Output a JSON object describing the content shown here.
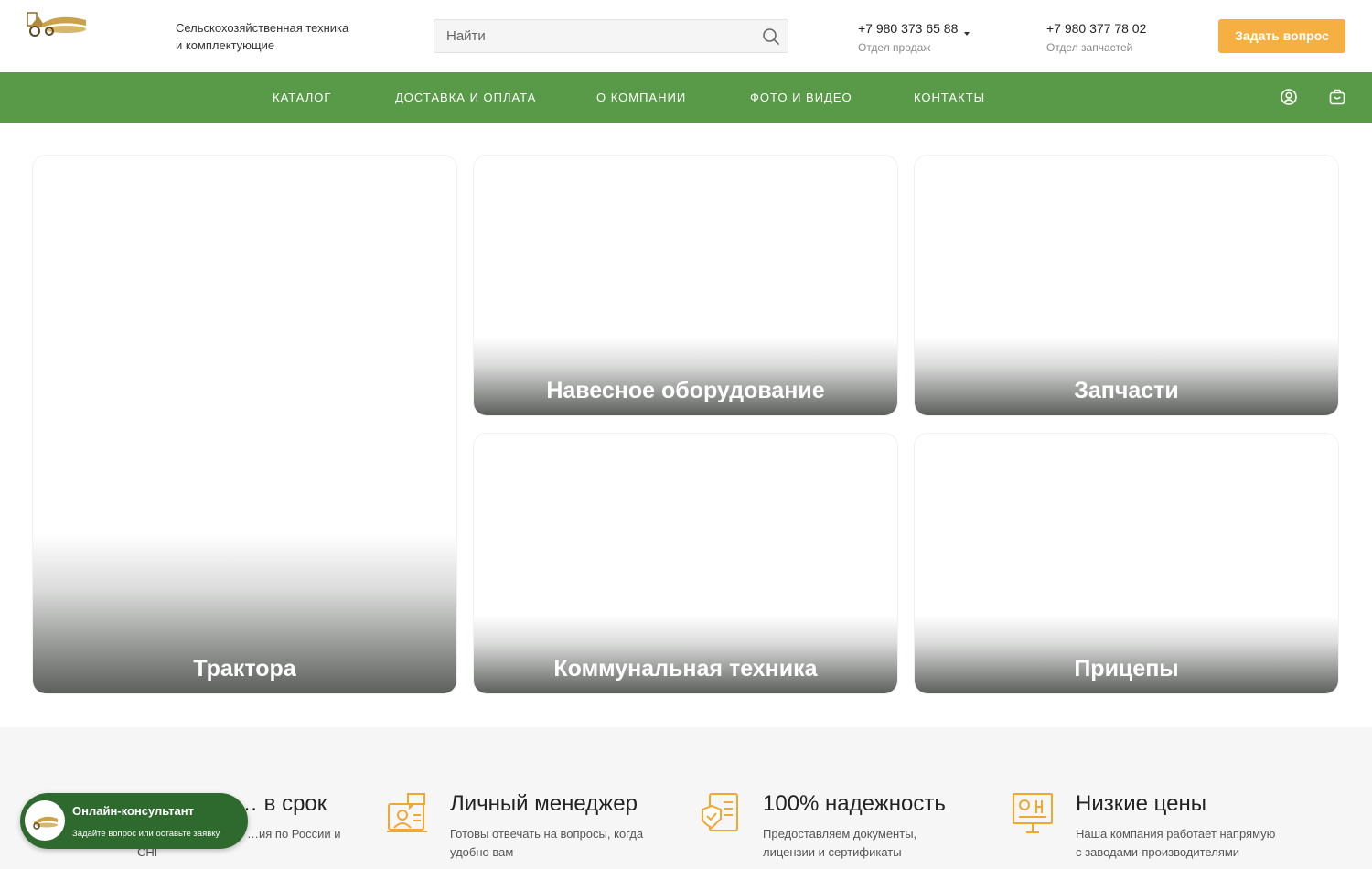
{
  "header": {
    "tagline_line1": "Сельскохозяйственная техника",
    "tagline_line2": "и комплектующие",
    "search_placeholder": "Найти",
    "phones": [
      {
        "number": "+7 980 373 65 88",
        "dept": "Отдел продаж"
      },
      {
        "number": "+7 980 377 78 02",
        "dept": "Отдел запчастей"
      }
    ],
    "ask_button": "Задать вопрос"
  },
  "nav": {
    "items": [
      "КАТАЛОГ",
      "ДОСТАВКА И ОПЛАТА",
      "О КОМПАНИИ",
      "ФОТО И ВИДЕО",
      "КОНТАКТЫ"
    ],
    "icons": [
      "user-icon",
      "cart-icon"
    ]
  },
  "catalog": {
    "tiles": [
      "Трактора",
      "Навесное оборудование",
      "Запчасти",
      "Коммунальная техника",
      "Прицепы"
    ]
  },
  "features": [
    {
      "title": "… в срок",
      "text_line1": "…ия по России и",
      "text_line2": "СНГ",
      "icon": "delivery-icon"
    },
    {
      "title": "Личный менеджер",
      "text_line1": "Готовы отвечать на вопросы, когда",
      "text_line2": "удобно вам",
      "icon": "manager-icon"
    },
    {
      "title": "100% надежность",
      "text_line1": "Предоставляем документы,",
      "text_line2": "лицензии и сертификаты",
      "icon": "certificate-icon"
    },
    {
      "title": "Низкие цены",
      "text_line1": "Наша компания работает напрямую",
      "text_line2": "с заводами-производителями",
      "icon": "price-board-icon"
    }
  ],
  "consultant": {
    "title": "Онлайн-консультант",
    "subtitle": "Задайте вопрос или оставьте заявку"
  },
  "colors": {
    "nav_green": "#589a47",
    "accent_orange": "#f5b041",
    "consultant_green": "#2e6a2e",
    "icon_orange": "#f0a830"
  }
}
